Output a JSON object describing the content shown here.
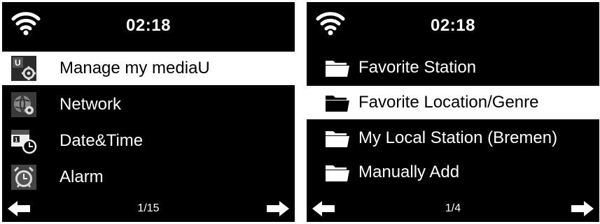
{
  "colors": {
    "screen_bg": "#000000",
    "text": "#ffffff",
    "highlight_bg": "#ffffff",
    "highlight_text": "#000000"
  },
  "left_screen": {
    "status": {
      "time": "02:18",
      "icon": "wifi-icon"
    },
    "menu": [
      {
        "label": "Manage my mediaU",
        "icon": "mediau-settings-icon",
        "selected": true
      },
      {
        "label": "Network",
        "icon": "network-globe-icon",
        "selected": false
      },
      {
        "label": "Date&Time",
        "icon": "calendar-clock-icon",
        "selected": false
      },
      {
        "label": "Alarm",
        "icon": "alarm-clock-icon",
        "selected": false
      }
    ],
    "footer": {
      "page": "1/15",
      "prev_icon": "arrow-left-icon",
      "next_icon": "arrow-right-icon"
    }
  },
  "right_screen": {
    "status": {
      "time": "02:18",
      "icon": "wifi-icon"
    },
    "menu": [
      {
        "label": "Favorite Station",
        "icon": "folder-icon",
        "selected": false
      },
      {
        "label": "Favorite Location/Genre",
        "icon": "folder-icon",
        "selected": true
      },
      {
        "label": "My Local Station (Bremen)",
        "icon": "folder-icon",
        "selected": false
      },
      {
        "label": "Manually Add",
        "icon": "folder-icon",
        "selected": false
      }
    ],
    "footer": {
      "page": "1/4",
      "prev_icon": "arrow-left-icon",
      "next_icon": "arrow-right-icon"
    }
  }
}
